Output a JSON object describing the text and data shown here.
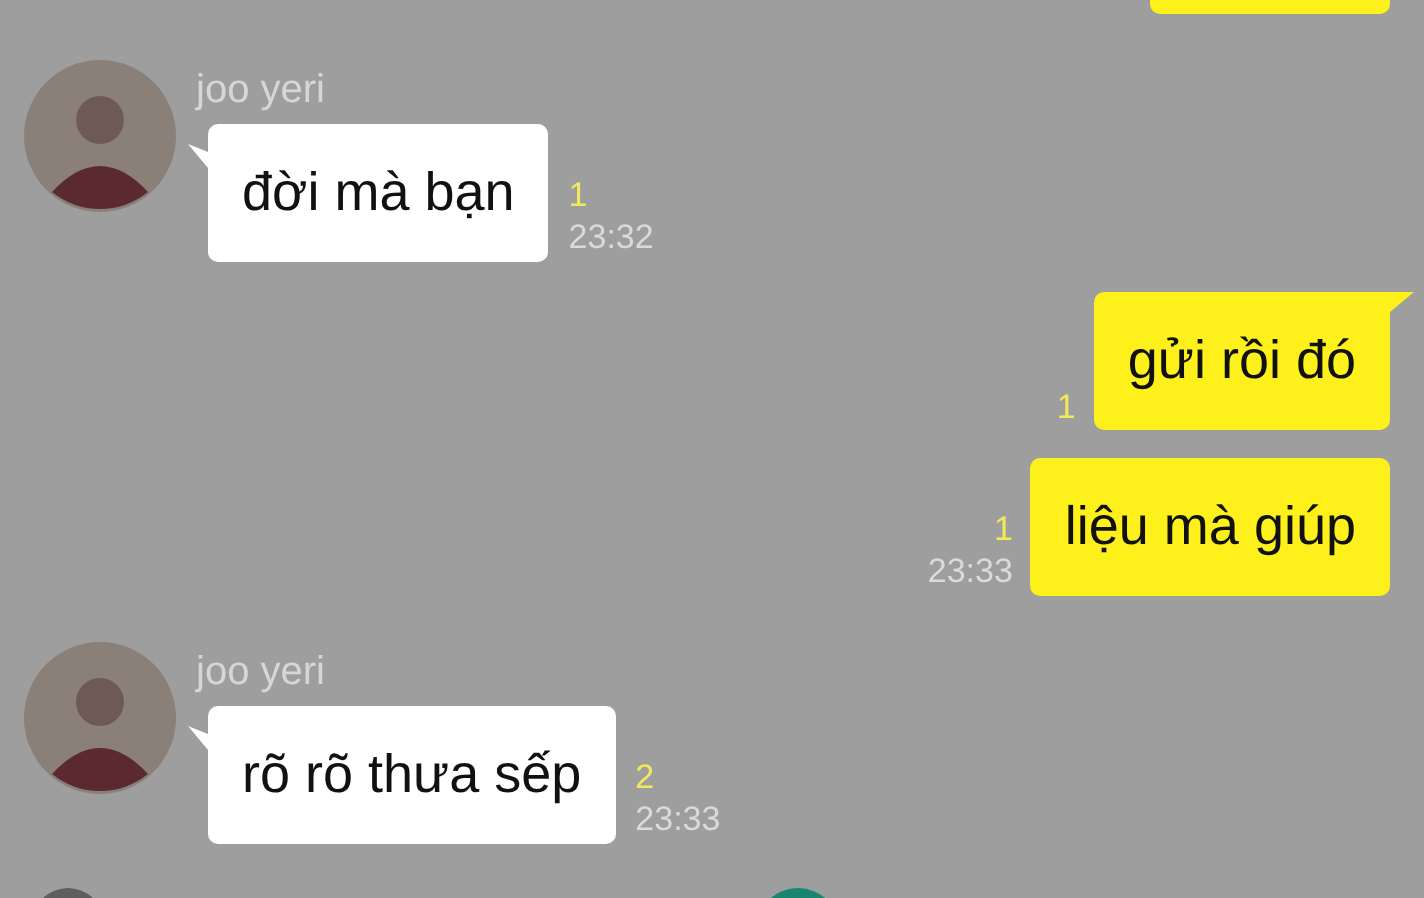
{
  "messages": [
    {
      "kind": "received",
      "sender": "joo yeri",
      "text": "đời mà bạn",
      "unread": "1",
      "time": "23:32",
      "tail": true
    },
    {
      "kind": "sent",
      "text": "gửi rồi đó",
      "unread": "1",
      "tail": true
    },
    {
      "kind": "sent",
      "text": "liệu mà giúp",
      "unread": "1",
      "time": "23:33",
      "tail": false
    },
    {
      "kind": "received",
      "sender": "joo yeri",
      "text": "rõ rõ thưa sếp",
      "unread": "2",
      "time": "23:33",
      "tail": true
    }
  ]
}
